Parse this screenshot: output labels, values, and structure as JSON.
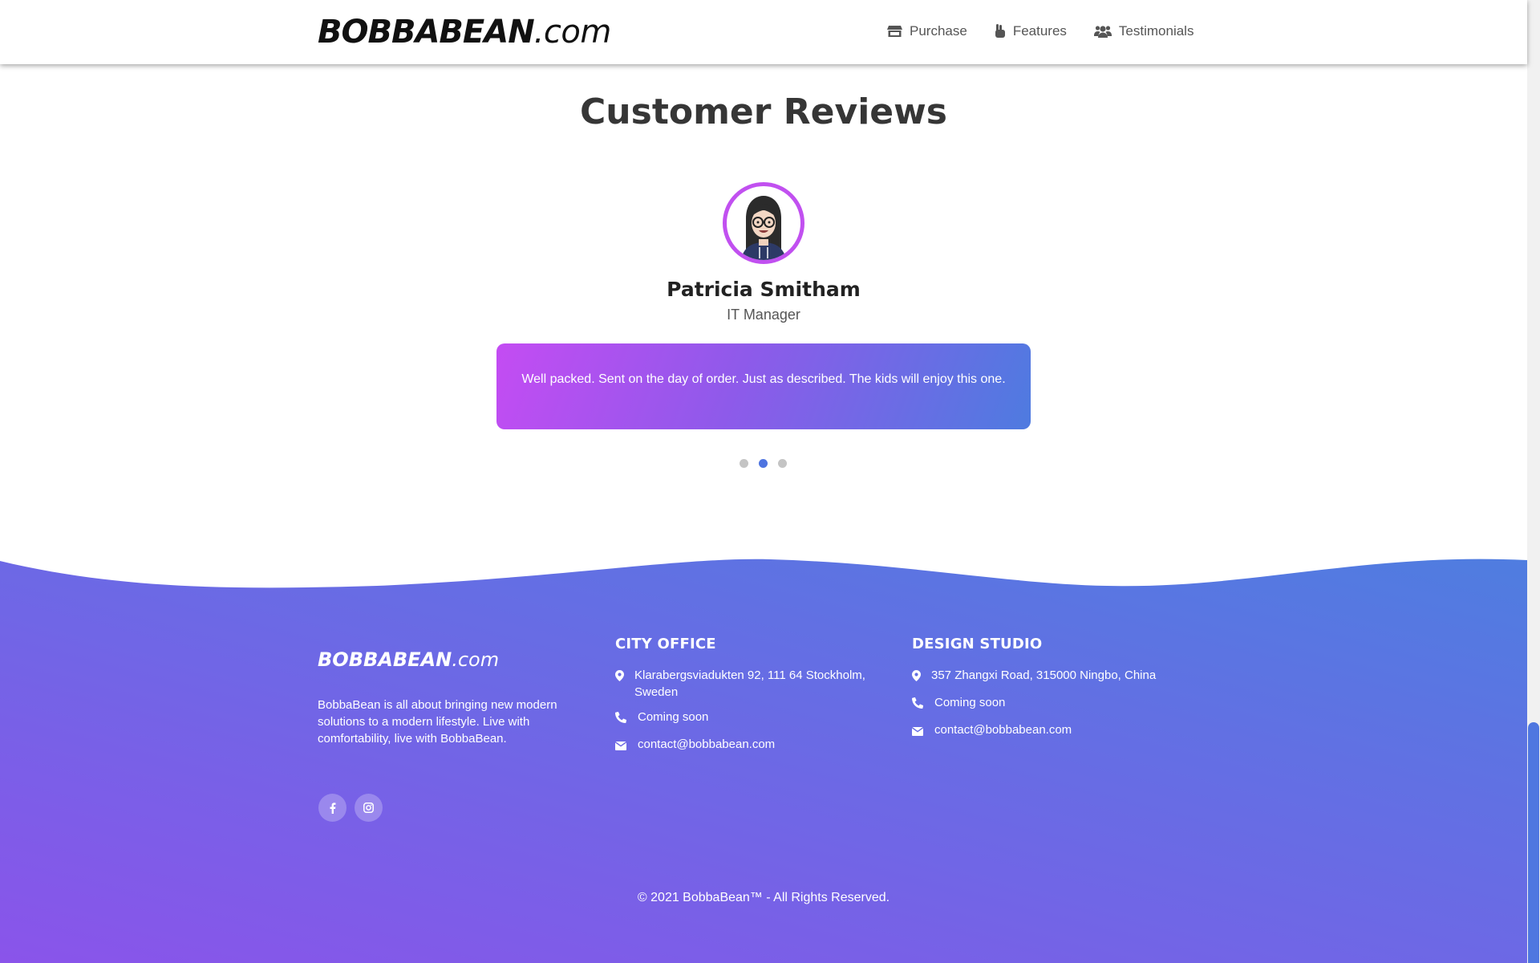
{
  "brand": {
    "bold": "BOBBABEAN",
    "suffix": ".com"
  },
  "nav": {
    "items": [
      {
        "label": "Purchase",
        "icon": "store-icon"
      },
      {
        "label": "Features",
        "icon": "hand-peace-icon"
      },
      {
        "label": "Testimonials",
        "icon": "users-icon"
      }
    ]
  },
  "reviews": {
    "title": "Customer Reviews",
    "name": "Patricia Smitham",
    "role": "IT Manager",
    "text": "Well packed. Sent on the day of order. Just as described. The kids will enjoy this one.",
    "slide_count": 3,
    "active_slide": 2
  },
  "footer": {
    "brand": {
      "bold": "BOBBABEAN",
      "suffix": ".com"
    },
    "about": "BobbaBean is all about bringing new modern solutions to a modern lifestyle. Live with comfortability, live with BobbaBean.",
    "social": [
      {
        "icon": "facebook-icon"
      },
      {
        "icon": "instagram-icon"
      }
    ],
    "city_office": {
      "title": "CITY OFFICE",
      "address": "Klarabergsviadukten 92, 111 64 Stockholm, Sweden",
      "phone": "Coming soon",
      "email": "contact@bobbabean.com"
    },
    "design_studio": {
      "title": "DESIGN STUDIO",
      "address": "357 Zhangxi Road, 315000 Ningbo, China",
      "phone": "Coming soon",
      "email": "contact@bobbabean.com"
    },
    "copyright": "© 2021 BobbaBean™ - All Rights Reserved."
  },
  "colors": {
    "accent_purple": "#c44cf3",
    "accent_blue": "#4e74e0",
    "footer_gradient_start": "#8a54ea",
    "footer_gradient_end": "#4f7de0"
  }
}
